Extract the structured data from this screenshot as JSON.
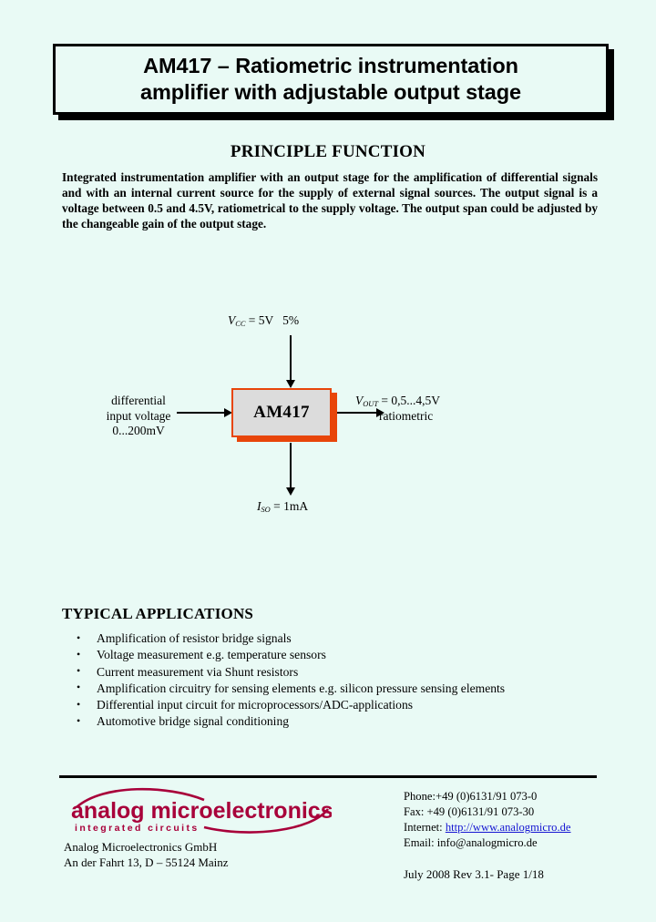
{
  "page": {
    "background_color": "#e9faf5"
  },
  "title": {
    "line1": "AM417 – Ratiometric instrumentation",
    "line2": "amplifier with adjustable output stage"
  },
  "principle": {
    "heading": "PRINCIPLE FUNCTION",
    "body": "Integrated instrumentation amplifier with an output stage for the amplification of differential signals and with an internal current source for the supply of external signal sources. The output signal is a voltage between 0.5 and 4.5V, ratiometrical to the supply voltage. The output span could be adjusted by the changeable gain of the output stage."
  },
  "diagram": {
    "block_label": "AM417",
    "block_fill_color": "#dcdcdc",
    "block_border_color": "#e8450a",
    "supply": {
      "symbol": "V",
      "subscript": "CC",
      "value": "= 5V",
      "tolerance": "5%"
    },
    "input": {
      "line1": "differential",
      "line2": "input voltage",
      "line3": "0...200mV"
    },
    "output": {
      "symbol": "V",
      "subscript": "OUT",
      "value": "= 0,5...4,5V",
      "note": "ratiometric"
    },
    "source_current": {
      "symbol": "I",
      "subscript": "SO",
      "value": "= 1mA"
    }
  },
  "applications": {
    "heading": "TYPICAL APPLICATIONS",
    "items": [
      "Amplification of resistor bridge signals",
      "Voltage measurement e.g. temperature sensors",
      "Current measurement via Shunt resistors",
      "Amplification circuitry for sensing elements e.g. silicon pressure sensing elements",
      "Differential input circuit for microprocessors/ADC-applications",
      "Automotive bridge signal conditioning"
    ]
  },
  "footer": {
    "logo": {
      "word": "analog microelectronics",
      "tagline": "integrated circuits",
      "color": "#a8003a"
    },
    "company": {
      "line1": "Analog Microelectronics GmbH",
      "line2": "An der Fahrt 13, D – 55124 Mainz"
    },
    "contact": {
      "phone": "Phone:+49 (0)6131/91 073-0",
      "fax": "Fax:   +49 (0)6131/91 073-30",
      "internet_label": "Internet: ",
      "internet_url": "http://www.analogmicro.de",
      "email": "Email: info@analogmicro.de"
    },
    "revision": "July 2008   Rev 3.1-  Page 1/18"
  }
}
